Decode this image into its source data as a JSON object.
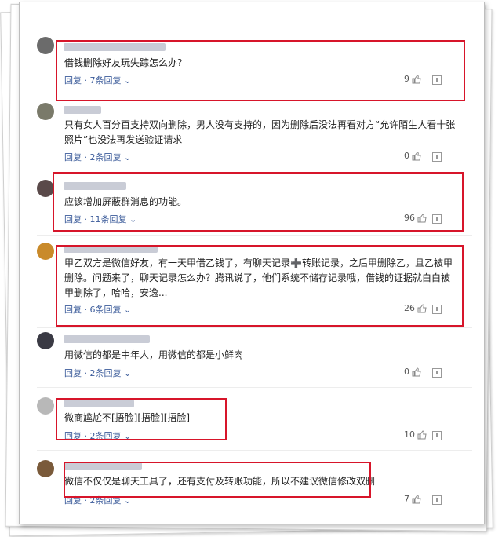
{
  "comments": [
    {
      "text": "借钱删除好友玩失踪怎么办?",
      "reply_label": "回复 ·",
      "replies": "7条回复",
      "likes": "9"
    },
    {
      "text": "只有女人百分百支持双向删除，男人没有支持的，因为删除后没法再看对方“允许陌生人看十张照片”也没法再发送验证请求",
      "reply_label": "回复 ·",
      "replies": "2条回复",
      "likes": "0"
    },
    {
      "text": "应该增加屏蔽群消息的功能。",
      "reply_label": "回复 ·",
      "replies": "11条回复",
      "likes": "96"
    },
    {
      "text": "甲乙双方是微信好友，有一天甲借乙钱了，有聊天记录➕转账记录，之后甲删除乙，且乙被甲删除。问题来了，聊天记录怎么办？腾讯说了，他们系统不储存记录哦，借钱的证据就白白被甲删除了，哈哈，安逸...",
      "reply_label": "回复 ·",
      "replies": "6条回复",
      "likes": "26"
    },
    {
      "text": "用微信的都是中年人，用微信的都是小鲜肉",
      "reply_label": "回复 ·",
      "replies": "2条回复",
      "likes": "0"
    },
    {
      "text": "微商尴尬不[捂脸][捂脸][捂脸]",
      "reply_label": "回复 ·",
      "replies": "2条回复",
      "likes": "10"
    },
    {
      "text": "微信不仅仅是聊天工具了，还有支付及转账功能，所以不建议微信修改双删",
      "reply_label": "回复 ·",
      "replies": "2条回复",
      "likes": "7"
    }
  ],
  "colors": {
    "highlight": "#d7152a",
    "link": "#3b5b9a"
  },
  "icons": {
    "like": "thumbs-up-icon",
    "report": "report-icon"
  }
}
